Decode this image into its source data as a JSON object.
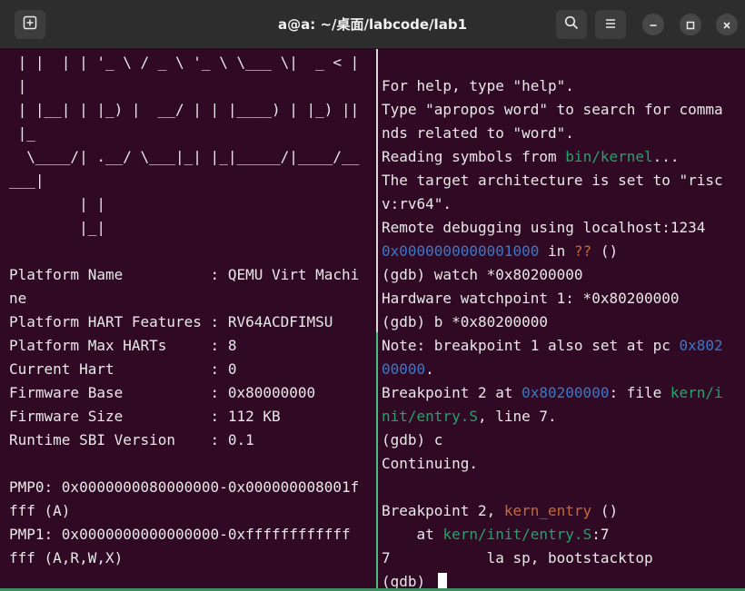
{
  "window": {
    "title": "a@a: ~/桌面/labcode/lab1",
    "buttons": {
      "new_tab_icon": "new-tab-icon",
      "search_icon": "search-icon",
      "menu_icon": "hamburger-menu-icon",
      "minimize_icon": "minimize-icon",
      "maximize_icon": "maximize-icon",
      "close_icon": "close-icon"
    }
  },
  "colors": {
    "terminal_bg": "#300a24",
    "text": "#e8e8e8",
    "address": "#3c78c8",
    "path": "#26a269",
    "function": "#c46a3a",
    "unknown": "#c46a3a"
  },
  "left_pane": {
    "lines": [
      [
        {
          "t": " | |  | | '_ \\ / _ \\ '_ \\ \\___ \\|  _ < |"
        }
      ],
      [
        {
          "t": " |"
        }
      ],
      [
        {
          "t": " | |__| | |_) |  __/ | | |____) | |_) ||"
        }
      ],
      [
        {
          "t": " |_"
        }
      ],
      [
        {
          "t": "  \\____/| .__/ \\___|_| |_|_____/|____/__"
        }
      ],
      [
        {
          "t": "___|"
        }
      ],
      [
        {
          "t": "        | |"
        }
      ],
      [
        {
          "t": "        |_|"
        }
      ],
      [
        {
          "t": ""
        }
      ],
      [
        {
          "t": "Platform Name          : QEMU Virt Machi"
        }
      ],
      [
        {
          "t": "ne"
        }
      ],
      [
        {
          "t": "Platform HART Features : RV64ACDFIMSU"
        }
      ],
      [
        {
          "t": "Platform Max HARTs     : 8"
        }
      ],
      [
        {
          "t": "Current Hart           : 0"
        }
      ],
      [
        {
          "t": "Firmware Base          : 0x80000000"
        }
      ],
      [
        {
          "t": "Firmware Size          : 112 KB"
        }
      ],
      [
        {
          "t": "Runtime SBI Version    : 0.1"
        }
      ],
      [
        {
          "t": ""
        }
      ],
      [
        {
          "t": "PMP0: 0x0000000080000000-0x000000008001f"
        }
      ],
      [
        {
          "t": "fff (A)"
        }
      ],
      [
        {
          "t": "PMP1: 0x0000000000000000-0xffffffffffff"
        }
      ],
      [
        {
          "t": "fff (A,R,W,X)"
        }
      ]
    ]
  },
  "right_pane": {
    "lines": [
      [
        {
          "t": ""
        }
      ],
      [
        {
          "t": "For help, type \"help\"."
        }
      ],
      [
        {
          "t": "Type \"apropos word\" to search for comma"
        }
      ],
      [
        {
          "t": "nds related to \"word\"."
        }
      ],
      [
        {
          "t": "Reading symbols from "
        },
        {
          "t": "bin/kernel",
          "c": "c-green"
        },
        {
          "t": "..."
        }
      ],
      [
        {
          "t": "The target architecture is set to \"risc"
        }
      ],
      [
        {
          "t": "v:rv64\"."
        }
      ],
      [
        {
          "t": "Remote debugging using localhost:1234"
        }
      ],
      [
        {
          "t": "0x0000000000001000",
          "c": "c-cyan"
        },
        {
          "t": " in "
        },
        {
          "t": "??",
          "c": "c-orange"
        },
        {
          "t": " ()"
        }
      ],
      [
        {
          "t": "(gdb) watch *0x80200000"
        }
      ],
      [
        {
          "t": "Hardware watchpoint 1: *0x80200000"
        }
      ],
      [
        {
          "t": "(gdb) b *0x80200000"
        }
      ],
      [
        {
          "t": "Note: breakpoint 1 also set at pc "
        },
        {
          "t": "0x802",
          "c": "c-cyan"
        }
      ],
      [
        {
          "t": "00000",
          "c": "c-cyan"
        },
        {
          "t": "."
        }
      ],
      [
        {
          "t": "Breakpoint 2 at "
        },
        {
          "t": "0x80200000",
          "c": "c-cyan"
        },
        {
          "t": ": file "
        },
        {
          "t": "kern/i",
          "c": "c-green"
        }
      ],
      [
        {
          "t": "nit/entry.S",
          "c": "c-green"
        },
        {
          "t": ", line 7."
        }
      ],
      [
        {
          "t": "(gdb) c"
        }
      ],
      [
        {
          "t": "Continuing."
        }
      ],
      [
        {
          "t": ""
        }
      ],
      [
        {
          "t": "Breakpoint 2, "
        },
        {
          "t": "kern_entry",
          "c": "c-orange"
        },
        {
          "t": " ()"
        }
      ],
      [
        {
          "t": "    at "
        },
        {
          "t": "kern/init/entry.S",
          "c": "c-green"
        },
        {
          "t": ":7"
        }
      ],
      [
        {
          "t": "7           la sp, bootstacktop"
        }
      ],
      [
        {
          "t": "(gdb) "
        }
      ]
    ]
  }
}
